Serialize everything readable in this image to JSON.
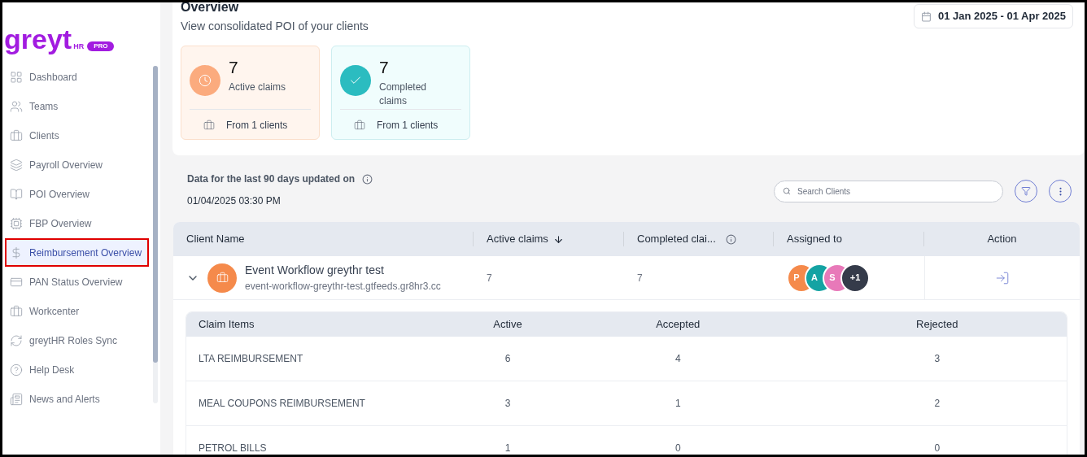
{
  "logo": {
    "text": "greyt",
    "sub": "HR",
    "badge": "PRO"
  },
  "sidebar": {
    "items": [
      {
        "label": "Dashboard",
        "selected": false
      },
      {
        "label": "Teams",
        "selected": false
      },
      {
        "label": "Clients",
        "selected": false
      },
      {
        "label": "Payroll Overview",
        "selected": false
      },
      {
        "label": "POI Overview",
        "selected": false
      },
      {
        "label": "FBP Overview",
        "selected": false
      },
      {
        "label": "Reimbursement Overview",
        "selected": true
      },
      {
        "label": "PAN Status Overview",
        "selected": false
      },
      {
        "label": "Workcenter",
        "selected": false
      },
      {
        "label": "greytHR Roles Sync",
        "selected": false
      },
      {
        "label": "Help Desk",
        "selected": false
      },
      {
        "label": "News and Alerts",
        "selected": false
      }
    ]
  },
  "header": {
    "title": "Overview",
    "subtitle": "View consolidated POI of your clients",
    "date_range": "01 Jan 2025 - 01 Apr 2025"
  },
  "stats": [
    {
      "kind": "active",
      "value": "7",
      "label": "Active claims",
      "footer": "From 1 clients"
    },
    {
      "kind": "completed",
      "value": "7",
      "label": "Completed claims",
      "footer": "From 1 clients"
    }
  ],
  "update_info": {
    "label": "Data for the last 90 days updated on",
    "timestamp": "01/04/2025 03:30 PM"
  },
  "search": {
    "placeholder": "Search Clients"
  },
  "table": {
    "columns": [
      "Client Name",
      "Active claims",
      "Completed clai...",
      "Assigned to",
      "Action"
    ],
    "rows": [
      {
        "name": "Event Workflow greythr test",
        "domain": "event-workflow-greythr-test.gtfeeds.gr8hr3.cc",
        "active": "7",
        "completed": "7",
        "expanded": true,
        "assignees": [
          {
            "initials": "P",
            "color": "#f58a4b"
          },
          {
            "initials": "A",
            "color": "#14a3a3"
          },
          {
            "initials": "S",
            "color": "#e879b9"
          },
          {
            "initials": "+1",
            "color": "#353b4a"
          }
        ],
        "claims": {
          "columns": [
            "Claim Items",
            "Active",
            "Accepted",
            "Rejected"
          ],
          "rows": [
            [
              "LTA REIMBURSEMENT",
              "6",
              "4",
              "3"
            ],
            [
              "MEAL COUPONS REIMBURSEMENT",
              "3",
              "1",
              "2"
            ],
            [
              "PETROL BILLS",
              "1",
              "0",
              "0"
            ]
          ]
        }
      }
    ]
  }
}
